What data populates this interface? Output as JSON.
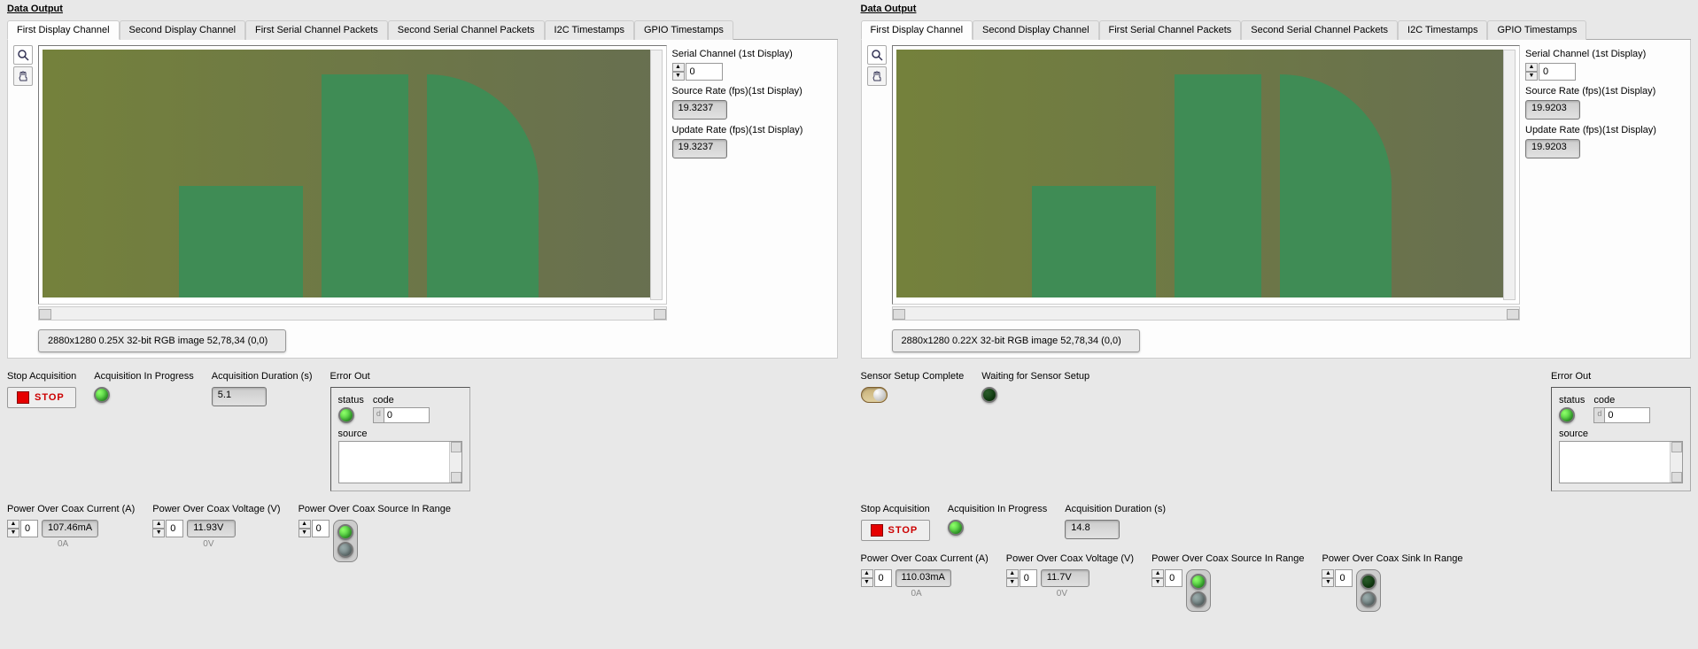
{
  "left": {
    "title": "Data Output",
    "tabs": [
      "First Display Channel",
      "Second Display Channel",
      "First Serial Channel Packets",
      "Second Serial Channel Packets",
      "I2C Timestamps",
      "GPIO Timestamps"
    ],
    "side": {
      "serial_label": "Serial Channel (1st Display)",
      "serial_value": "0",
      "source_rate_label": "Source Rate (fps)(1st Display)",
      "source_rate_value": "19.3237",
      "update_rate_label": "Update Rate (fps)(1st Display)",
      "update_rate_value": "19.3237"
    },
    "image_info": "2880x1280 0.25X 32-bit RGB image 52,78,34   (0,0)",
    "stop_label": "Stop Acquisition",
    "stop_btn": "STOP",
    "acq_prog_label": "Acquisition In Progress",
    "acq_dur_label": "Acquisition Duration (s)",
    "acq_dur_value": "5.1",
    "error_label": "Error Out",
    "error": {
      "status_label": "status",
      "code_label": "code",
      "code_value": "0",
      "source_label": "source"
    },
    "poc_current_label": "Power Over Coax Current (A)",
    "poc_current_idx": "0",
    "poc_current_value": "107.46mA",
    "poc_current_sub": "0A",
    "poc_voltage_label": "Power Over Coax Voltage (V)",
    "poc_voltage_idx": "0",
    "poc_voltage_value": "11.93V",
    "poc_voltage_sub": "0V",
    "poc_source_label": "Power Over Coax Source In Range",
    "poc_source_idx": "0"
  },
  "right": {
    "title": "Data Output",
    "tabs": [
      "First Display Channel",
      "Second Display Channel",
      "First Serial Channel Packets",
      "Second Serial Channel Packets",
      "I2C Timestamps",
      "GPIO Timestamps"
    ],
    "side": {
      "serial_label": "Serial Channel (1st Display)",
      "serial_value": "0",
      "source_rate_label": "Source Rate (fps)(1st Display)",
      "source_rate_value": "19.9203",
      "update_rate_label": "Update Rate (fps)(1st Display)",
      "update_rate_value": "19.9203"
    },
    "image_info": "2880x1280 0.22X 32-bit RGB image 52,78,34   (0,0)",
    "sensor_complete_label": "Sensor Setup Complete",
    "sensor_waiting_label": "Waiting for Sensor Setup",
    "stop_label": "Stop Acquisition",
    "stop_btn": "STOP",
    "acq_prog_label": "Acquisition In Progress",
    "acq_dur_label": "Acquisition Duration (s)",
    "acq_dur_value": "14.8",
    "error_label": "Error Out",
    "error": {
      "status_label": "status",
      "code_label": "code",
      "code_value": "0",
      "source_label": "source"
    },
    "poc_current_label": "Power Over Coax Current (A)",
    "poc_current_idx": "0",
    "poc_current_value": "110.03mA",
    "poc_current_sub": "0A",
    "poc_voltage_label": "Power Over Coax Voltage (V)",
    "poc_voltage_idx": "0",
    "poc_voltage_value": "11.7V",
    "poc_voltage_sub": "0V",
    "poc_source_label": "Power Over Coax Source In Range",
    "poc_source_idx": "0",
    "poc_sink_label": "Power Over Coax Sink In Range",
    "poc_sink_idx": "0"
  }
}
